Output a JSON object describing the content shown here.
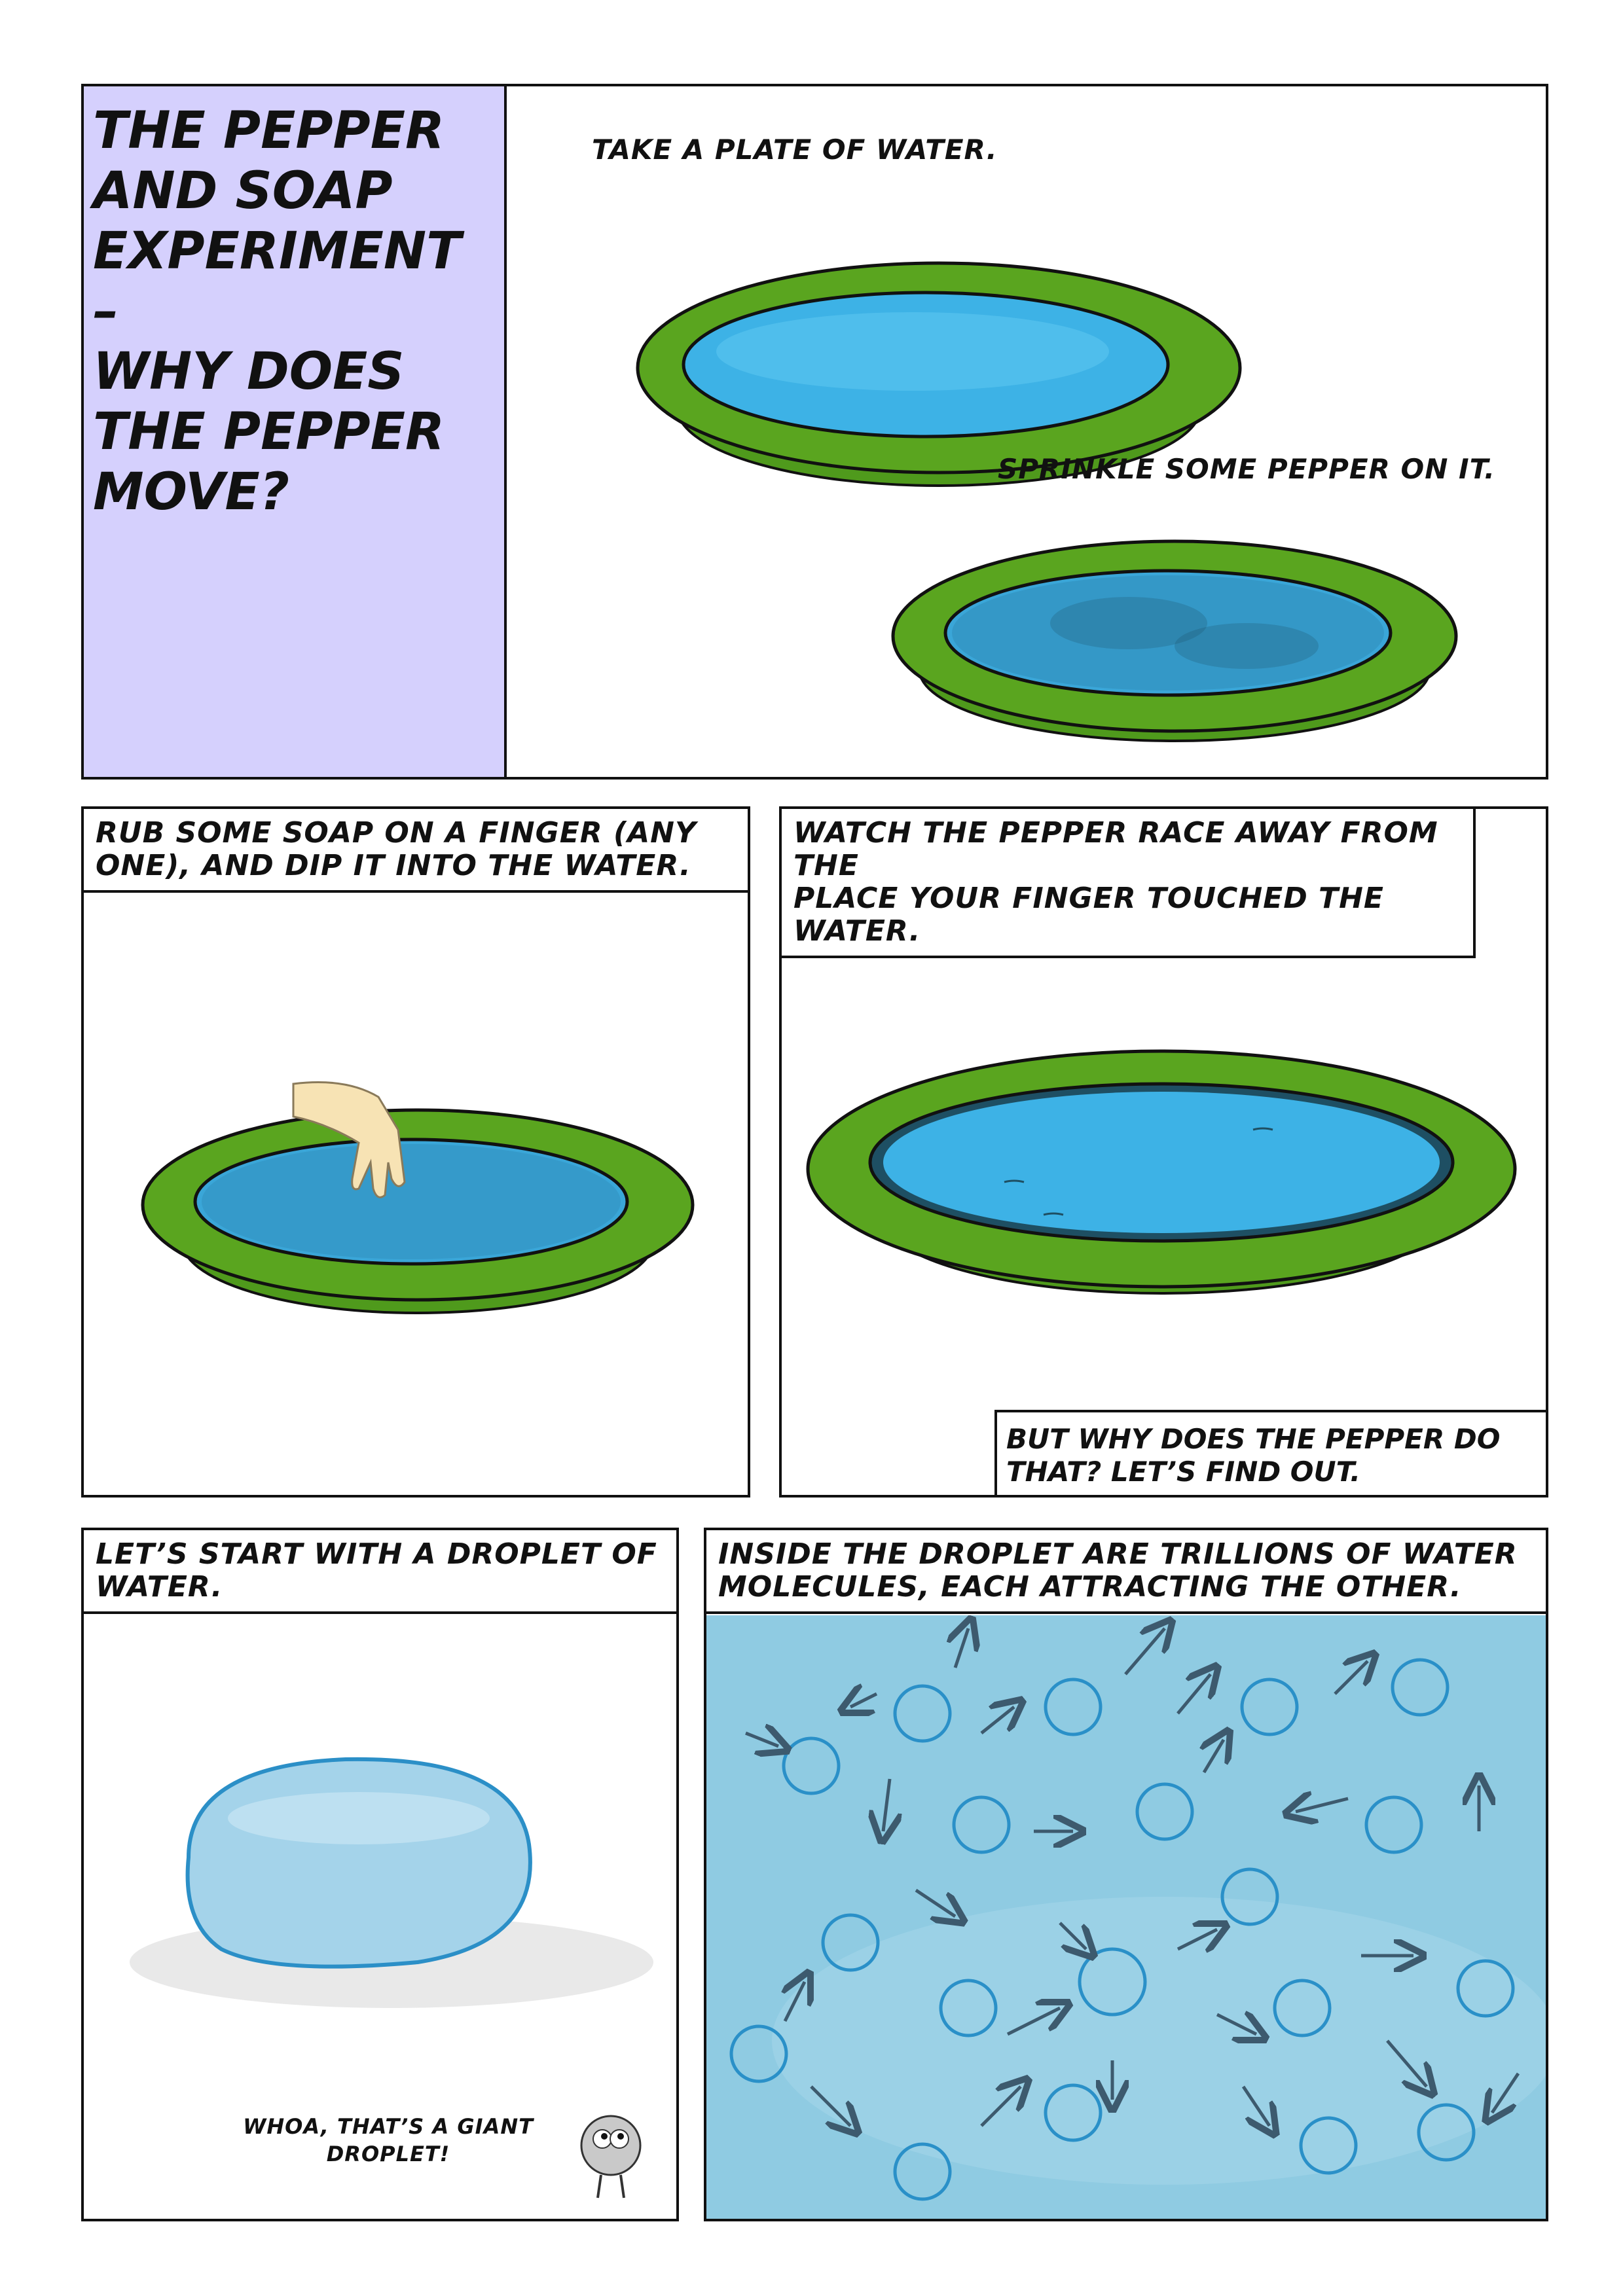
{
  "title_panel": {
    "lines": [
      "THE PEPPER",
      "AND SOAP",
      "EXPERIMENT",
      "–",
      "WHY DOES",
      "THE PEPPER",
      "MOVE?"
    ],
    "background_color": "#d5d0fd"
  },
  "panel1": {
    "step1": "TAKE A PLATE OF WATER.",
    "step2": "SPRINKLE SOME PEPPER ON IT."
  },
  "panel2": {
    "caption_line1": "RUB SOME SOAP ON A FINGER (ANY",
    "caption_line2": "ONE), AND DIP IT INTO THE WATER."
  },
  "panel3": {
    "caption_line1": "WATCH THE PEPPER RACE AWAY FROM THE",
    "caption_line2": "PLACE YOUR FINGER TOUCHED THE WATER.",
    "box_line1": "BUT WHY DOES THE PEPPER DO",
    "box_line2": "THAT? LET’S FIND OUT."
  },
  "panel4": {
    "caption_line1": "LET’S START WITH A DROPLET OF",
    "caption_line2": "WATER.",
    "speech_line1": "WHOA, THAT’S A GIANT",
    "speech_line2": "DROPLET!"
  },
  "panel5": {
    "caption_line1": "INSIDE THE DROPLET ARE TRILLIONS OF WATER",
    "caption_line2": "MOLECULES, EACH ATTRACTING THE OTHER."
  },
  "colors": {
    "plate_green": "#5aa51f",
    "water_blue": "#3db2e6",
    "molecule_bg": "#8fcbe2"
  }
}
